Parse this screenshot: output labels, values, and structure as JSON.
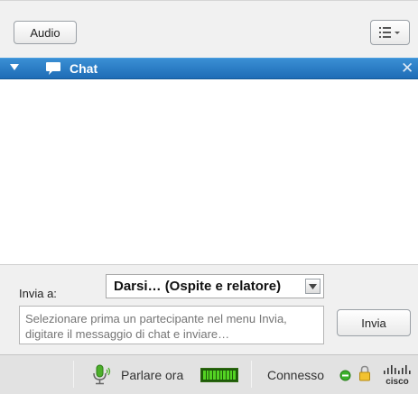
{
  "toolbar": {
    "audio_label": "Audio",
    "menu_icon": "list-menu-icon"
  },
  "chat_panel": {
    "title": "Chat",
    "collapse_icon": "triangle-down-icon",
    "chat_icon": "speech-bubble-icon",
    "close_glyph": "✕",
    "accent_color": "#1e6cb6"
  },
  "compose": {
    "send_to_label": "Invia a:",
    "send_to_value": "Darsi… (Ospite e relatore)",
    "message_placeholder": "Selezionare prima un partecipante nel menu Invia, digitare il messaggio di chat e inviare…",
    "send_label": "Invia"
  },
  "status_bar": {
    "speak_label": "Parlare ora",
    "connected_label": "Connesso",
    "status_color": "#3ab02a",
    "icons": [
      "microphone-icon",
      "audio-level-meter",
      "connection-status-icon",
      "lock-icon",
      "cisco-logo"
    ],
    "cisco_logo_text": "cisco"
  }
}
